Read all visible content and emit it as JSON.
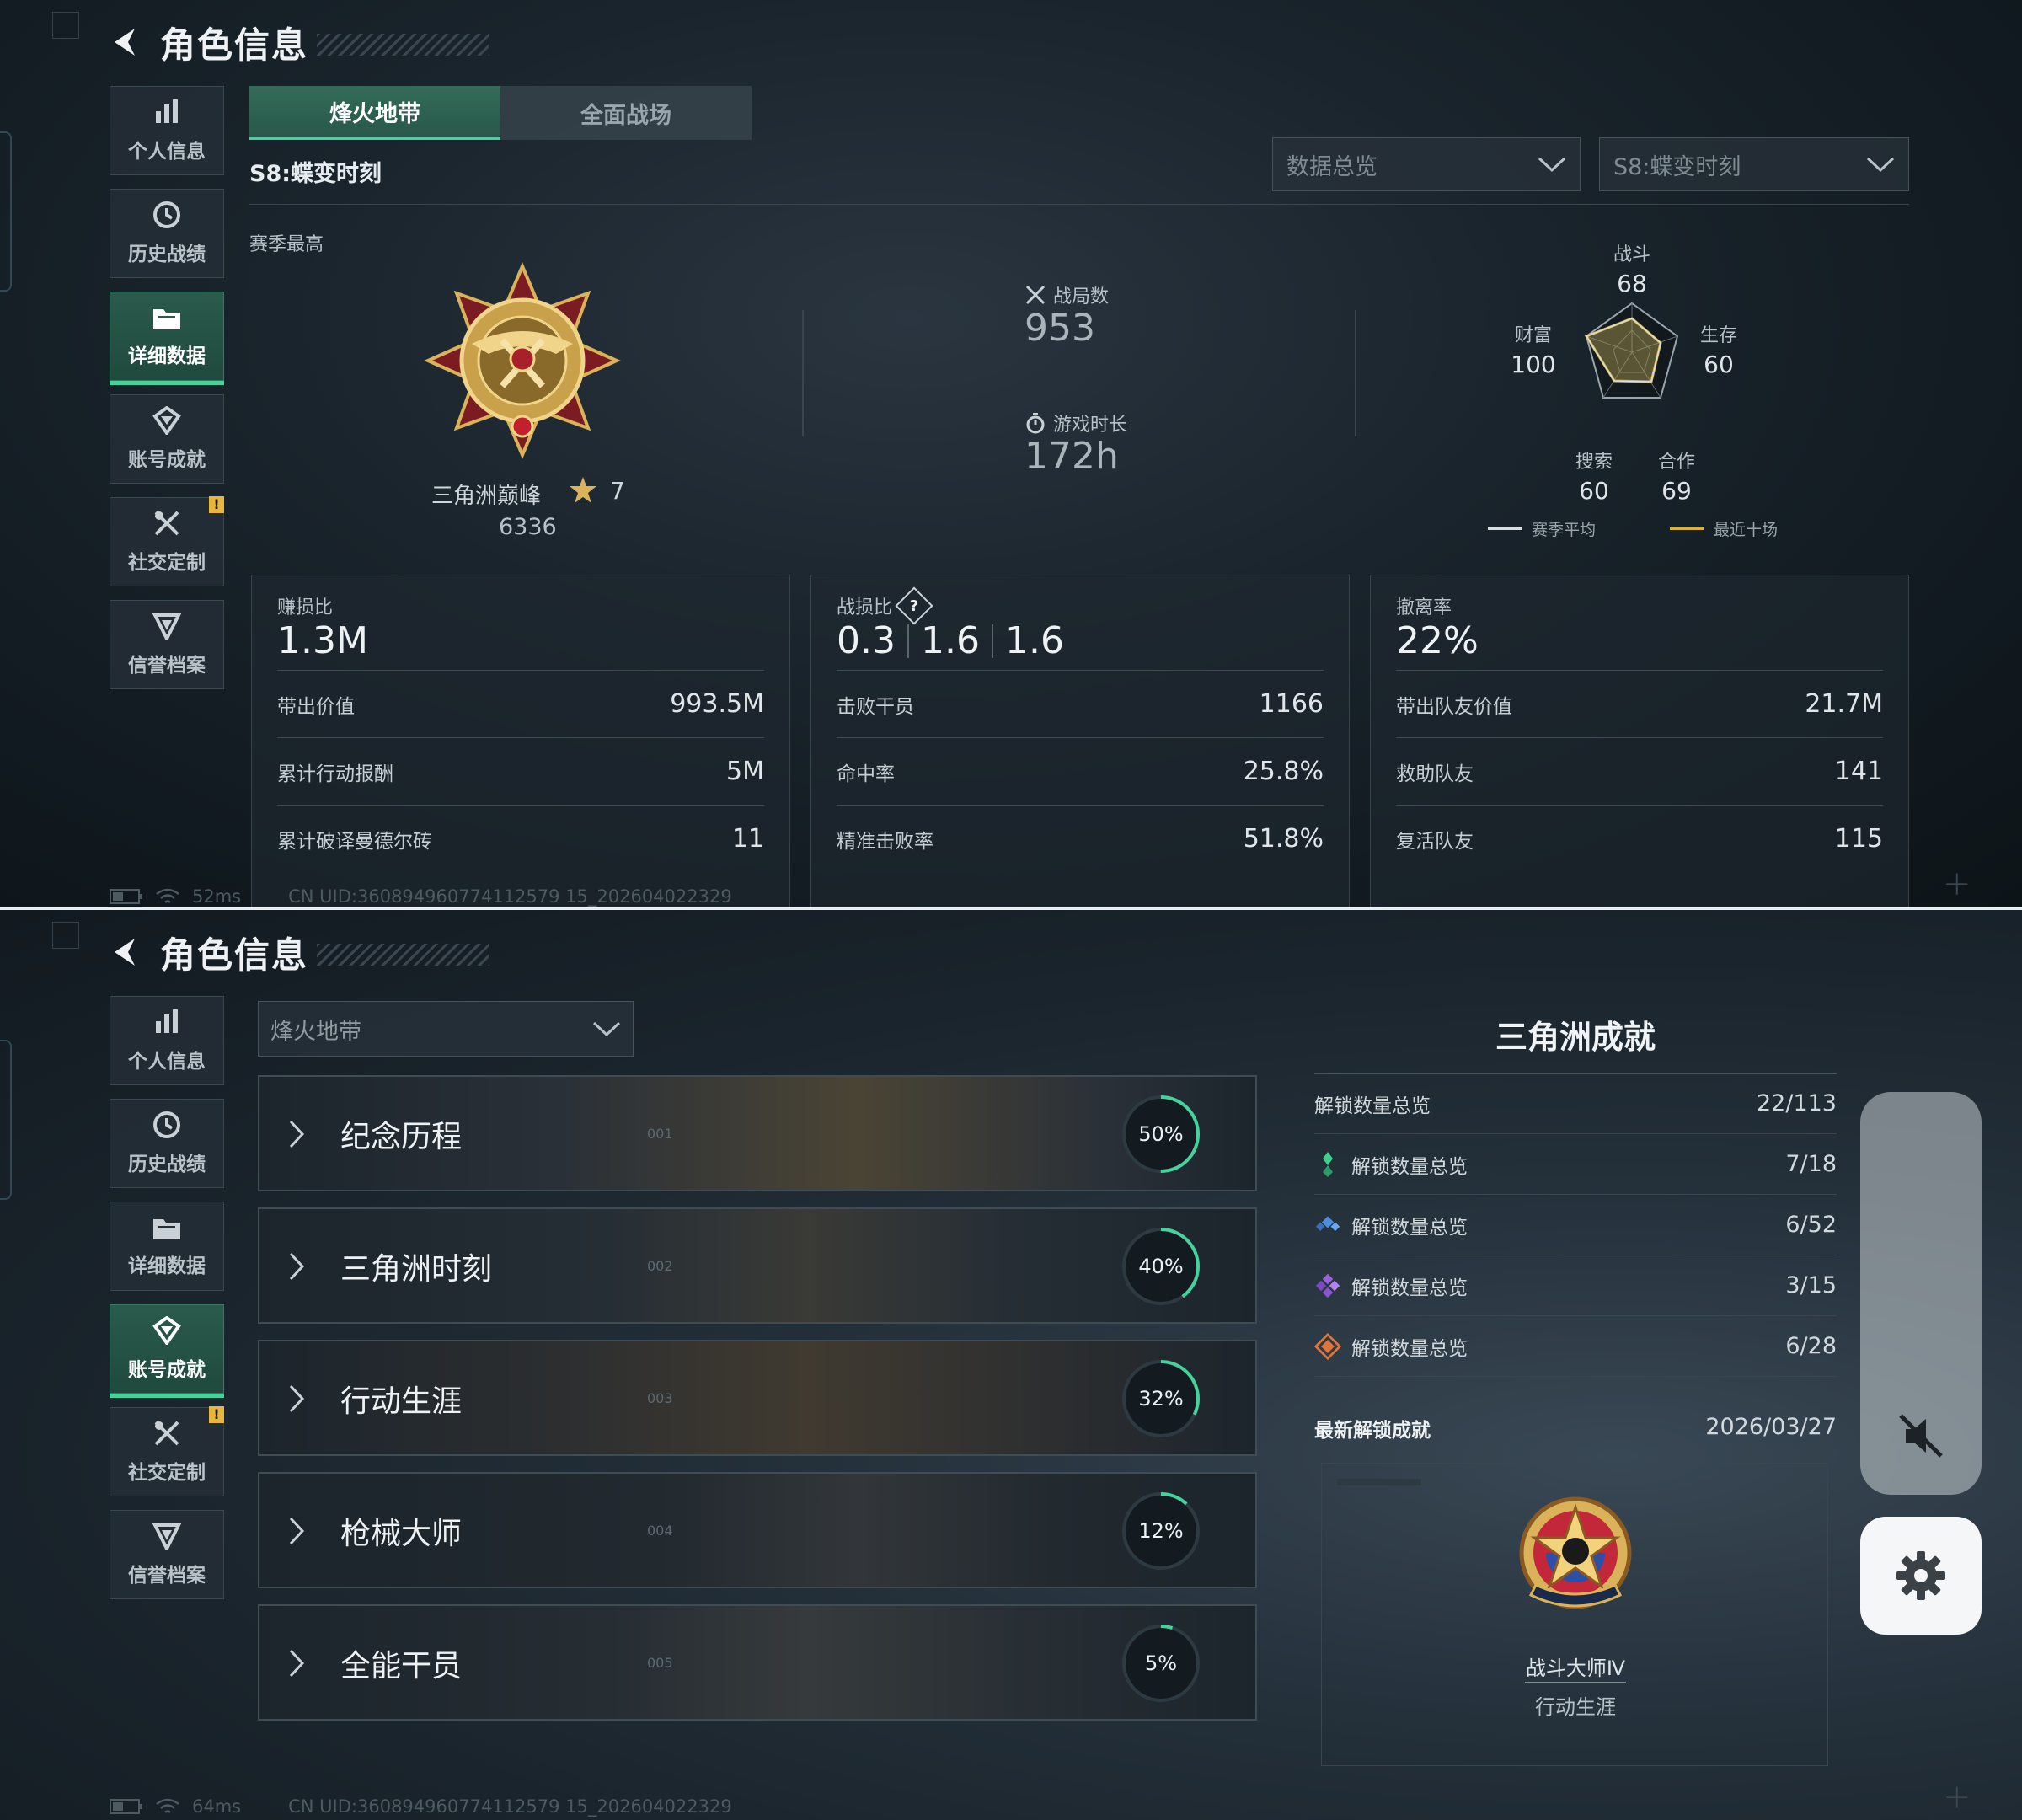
{
  "page": {
    "title": "角色信息"
  },
  "sidebar": {
    "items": [
      {
        "label": "个人信息",
        "icon": "bar-chart-icon"
      },
      {
        "label": "历史战绩",
        "icon": "clock-icon"
      },
      {
        "label": "详细数据",
        "icon": "folder-icon"
      },
      {
        "label": "账号成就",
        "icon": "achievement-icon"
      },
      {
        "label": "社交定制",
        "icon": "tools-icon",
        "badge": "!"
      },
      {
        "label": "信誉档案",
        "icon": "shield-icon"
      }
    ]
  },
  "top": {
    "active_sidebar": "详细数据",
    "tabs": [
      "烽火地带",
      "全面战场"
    ],
    "active_tab": "烽火地带",
    "season": "S8:蝶变时刻",
    "select_overview": "数据总览",
    "select_season": "S8:蝶变时刻",
    "season_best_label": "赛季最高",
    "rank": {
      "name": "三角洲巅峰",
      "stars": "7",
      "score": "6336"
    },
    "matches_label": "战局数",
    "matches": "953",
    "playtime_label": "游戏时长",
    "playtime": "172h",
    "radar": {
      "labels": {
        "combat": "战斗",
        "survival": "生存",
        "cooperation": "合作",
        "search": "搜索",
        "wealth": "财富"
      },
      "values": {
        "combat": "68",
        "survival": "60",
        "cooperation": "69",
        "search": "60",
        "wealth": "100"
      },
      "legend_avg": "赛季平均",
      "legend_recent": "最近十场",
      "color_avg": "#d8dee2",
      "color_recent": "#d9b23a"
    },
    "cards": [
      {
        "label": "赚损比",
        "big": "1.3M",
        "rows": [
          {
            "k": "带出价值",
            "v": "993.5M"
          },
          {
            "k": "累计行动报酬",
            "v": "5M"
          },
          {
            "k": "累计破译曼德尔砖",
            "v": "11"
          }
        ]
      },
      {
        "label": "战损比",
        "help": "?",
        "big_parts": [
          "0.3",
          "1.6",
          "1.6"
        ],
        "rows": [
          {
            "k": "击败干员",
            "v": "1166"
          },
          {
            "k": "命中率",
            "v": "25.8%"
          },
          {
            "k": "精准击败率",
            "v": "51.8%"
          }
        ]
      },
      {
        "label": "撤离率",
        "big": "22%",
        "rows": [
          {
            "k": "带出队友价值",
            "v": "21.7M"
          },
          {
            "k": "救助队友",
            "v": "141"
          },
          {
            "k": "复活队友",
            "v": "115"
          }
        ]
      }
    ],
    "footer": {
      "latency": "52ms",
      "uid": "CN UID:360894960774112579 15_202604022329"
    }
  },
  "bottom": {
    "active_sidebar": "账号成就",
    "select_mode": "烽火地带",
    "categories": [
      {
        "name": "纪念历程",
        "idx": "001",
        "percent": "50%",
        "progress": 0.5
      },
      {
        "name": "三角洲时刻",
        "idx": "002",
        "percent": "40%",
        "progress": 0.4
      },
      {
        "name": "行动生涯",
        "idx": "003",
        "percent": "32%",
        "progress": 0.32
      },
      {
        "name": "枪械大师",
        "idx": "004",
        "percent": "12%",
        "progress": 0.12
      },
      {
        "name": "全能干员",
        "idx": "005",
        "percent": "5%",
        "progress": 0.05
      }
    ],
    "summary": {
      "title": "三角洲成就",
      "total_label": "解锁数量总览",
      "total": "22/113",
      "rows": [
        {
          "k": "解锁数量总览",
          "v": "7/18",
          "gem_color": "#3fcf8e"
        },
        {
          "k": "解锁数量总览",
          "v": "6/52",
          "gem_color": "#4a8fe0"
        },
        {
          "k": "解锁数量总览",
          "v": "3/15",
          "gem_color": "#9a62e0"
        },
        {
          "k": "解锁数量总览",
          "v": "6/28",
          "gem_color": "#e0753a"
        }
      ],
      "latest_label": "最新解锁成就",
      "latest_date": "2026/03/27",
      "badge_name": "战斗大师Ⅳ",
      "badge_category": "行动生涯"
    },
    "footer": {
      "latency": "64ms",
      "uid": "CN UID:360894960774112579 15_202604022329"
    }
  },
  "colors": {
    "accent": "#46d39b",
    "badge": "#e8b63a"
  }
}
